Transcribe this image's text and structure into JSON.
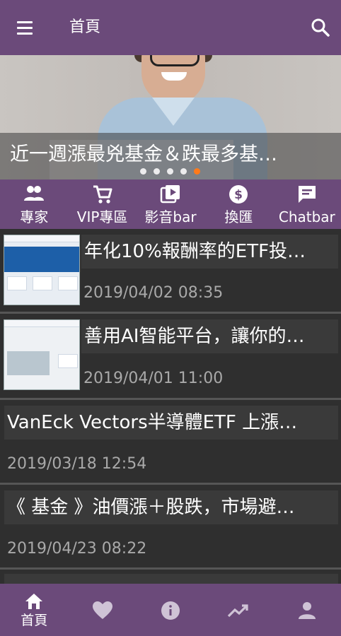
{
  "appbar": {
    "title": "首頁",
    "menu_icon": "hamburger-menu-icon",
    "search_icon": "search-icon"
  },
  "banner": {
    "caption": "近一週漲最兇基金＆跌最多基…",
    "slide_count": 5,
    "active_slide": 5,
    "active_dot_color": "#ff7a1a"
  },
  "shortcuts": [
    {
      "label": "專家",
      "icon": "people-icon"
    },
    {
      "label": "VIP專區",
      "icon": "cart-icon"
    },
    {
      "label": "影音bar",
      "icon": "video-icon"
    },
    {
      "label": "換匯",
      "icon": "dollar-coin-icon"
    },
    {
      "label": "Chatbar",
      "icon": "chat-icon"
    }
  ],
  "feed": [
    {
      "title": "年化10%報酬率的ETF投…",
      "date": "2019/04/02 08:35",
      "has_thumb": true
    },
    {
      "title": "善用AI智能平台，讓你的…",
      "date": "2019/04/01 11:00",
      "has_thumb": true
    },
    {
      "title": "VanEck Vectors半導體ETF 上漲…",
      "date": "2019/03/18 12:54",
      "has_thumb": false
    },
    {
      "title": "《 基金 》油價漲＋股跌，市場避…",
      "date": "2019/04/23 08:22",
      "has_thumb": false
    }
  ],
  "bottomnav": [
    {
      "label": "首頁",
      "icon": "home-icon",
      "active": true
    },
    {
      "label": "",
      "icon": "heart-icon",
      "active": false
    },
    {
      "label": "",
      "icon": "info-icon",
      "active": false
    },
    {
      "label": "",
      "icon": "trending-up-icon",
      "active": false
    },
    {
      "label": "",
      "icon": "person-icon",
      "active": false
    }
  ],
  "colors": {
    "primary": "#6b4a7a",
    "background": "#2b2b2b",
    "card": "#2f2f2f",
    "date_text": "#a9a9a9"
  }
}
